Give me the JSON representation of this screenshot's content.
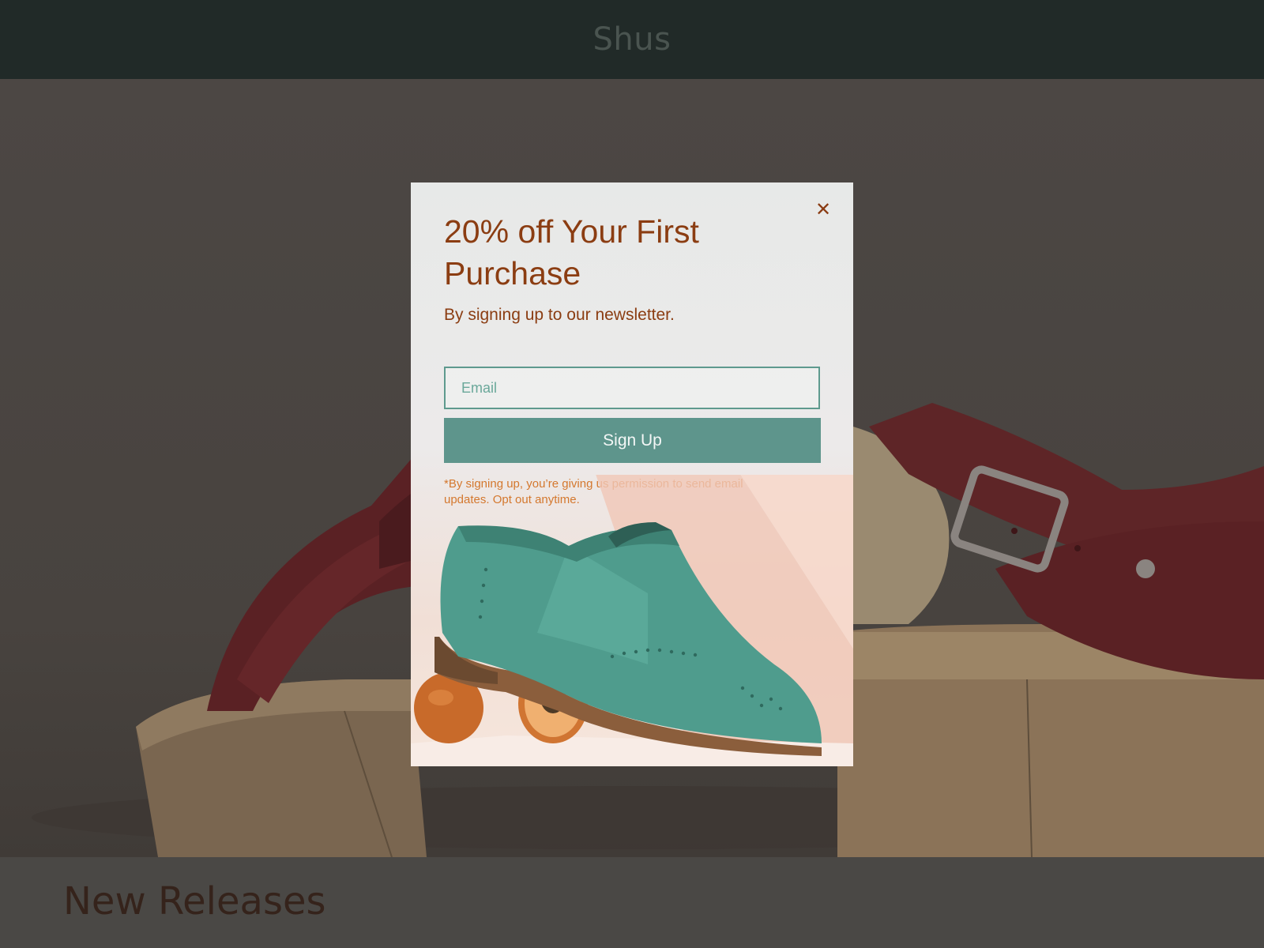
{
  "header": {
    "brand": "Shus"
  },
  "hero": {
    "image": "sandal-hero-image"
  },
  "modal": {
    "close_icon": "close-icon",
    "close_glyph": "✕",
    "title": "20% off Your First Purchase",
    "subtitle": "By signing up to our newsletter.",
    "email": {
      "value": "",
      "placeholder": "Email"
    },
    "button_label": "Sign Up",
    "legal": "*By signing up, you’re giving us permission to send email updates. Opt out anytime.",
    "image": "green-brogue-shoe-with-apricots"
  },
  "section": {
    "title": "New Releases"
  },
  "colors": {
    "header_bg": "#212a28",
    "accent_text": "#8b3d12",
    "button_bg": "#5e958c",
    "legal_text": "#d4782e",
    "overlay": "#4a4744"
  }
}
